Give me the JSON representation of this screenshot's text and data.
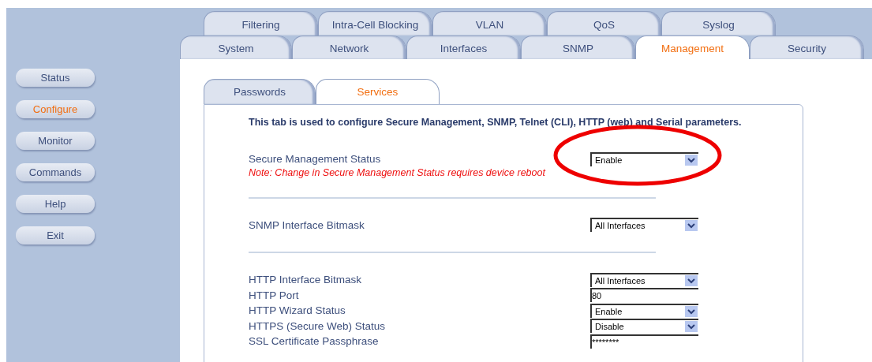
{
  "tabs_row_1": [
    {
      "label": "Filtering",
      "selected": false
    },
    {
      "label": "Intra-Cell Blocking",
      "selected": false
    },
    {
      "label": "VLAN",
      "selected": false
    },
    {
      "label": "QoS",
      "selected": false
    },
    {
      "label": "Syslog",
      "selected": false
    }
  ],
  "tabs_row_2": [
    {
      "label": "System",
      "selected": false
    },
    {
      "label": "Network",
      "selected": false
    },
    {
      "label": "Interfaces",
      "selected": false
    },
    {
      "label": "SNMP",
      "selected": false
    },
    {
      "label": "Management",
      "selected": true
    },
    {
      "label": "Security",
      "selected": false
    }
  ],
  "sidebar": {
    "items": [
      {
        "label": "Status",
        "selected": false
      },
      {
        "label": "Configure",
        "selected": true
      },
      {
        "label": "Monitor",
        "selected": false
      },
      {
        "label": "Commands",
        "selected": false
      },
      {
        "label": "Help",
        "selected": false
      },
      {
        "label": "Exit",
        "selected": false
      }
    ]
  },
  "sub_tabs": [
    {
      "label": "Passwords",
      "selected": false
    },
    {
      "label": "Services",
      "selected": true
    }
  ],
  "intro": "This tab is used to configure Secure Management, SNMP, Telnet (CLI), HTTP (web) and Serial parameters.",
  "sections": [
    {
      "fields": [
        {
          "label": "Secure Management Status",
          "kind": "select",
          "value": "Enable"
        }
      ],
      "note": "Note: Change in Secure Management Status requires device reboot"
    },
    {
      "fields": [
        {
          "label": "SNMP Interface Bitmask",
          "kind": "select",
          "value": "All Interfaces"
        }
      ]
    },
    {
      "fields": [
        {
          "label": "HTTP Interface Bitmask",
          "kind": "select",
          "value": "All Interfaces"
        },
        {
          "label": "HTTP Port",
          "kind": "text",
          "value": "80"
        },
        {
          "label": "HTTP Wizard Status",
          "kind": "select",
          "value": "Enable"
        },
        {
          "label": "HTTPS (Secure Web) Status",
          "kind": "select",
          "value": "Disable"
        },
        {
          "label": "SSL Certificate Passphrase",
          "kind": "text",
          "value": "********"
        }
      ]
    }
  ],
  "annotation": {
    "kind": "ellipse"
  }
}
